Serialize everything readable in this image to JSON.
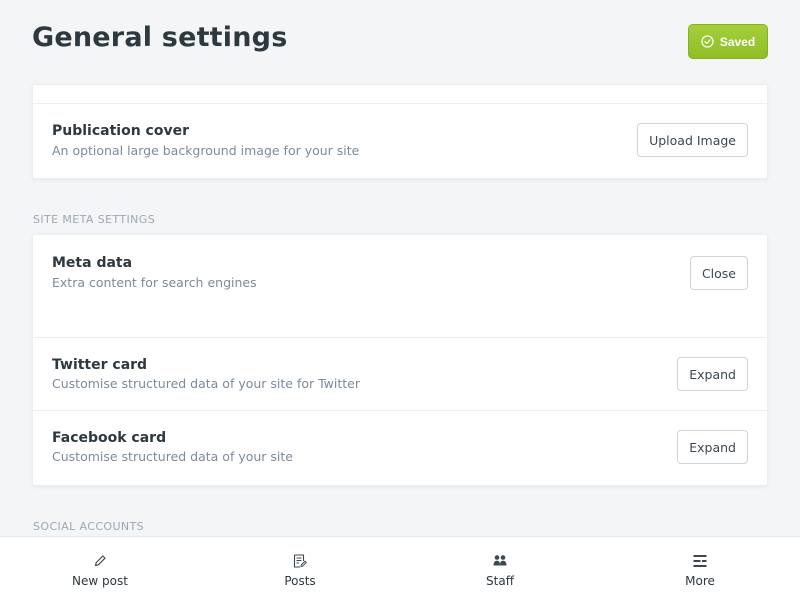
{
  "header": {
    "title": "General settings",
    "saved_label": "Saved",
    "saved_color": "#9ccb36"
  },
  "publication": {
    "cover_title": "Publication cover",
    "cover_desc": "An optional large background image for your site",
    "upload_label": "Upload Image"
  },
  "site_meta": {
    "section_label": "SITE META SETTINGS",
    "rows": [
      {
        "title": "Meta data",
        "desc": "Extra content for search engines",
        "button": "Close"
      },
      {
        "title": "Twitter card",
        "desc": "Customise structured data of your site for Twitter",
        "button": "Expand"
      },
      {
        "title": "Facebook card",
        "desc": "Customise structured data of your site",
        "button": "Expand"
      }
    ]
  },
  "social": {
    "section_label": "SOCIAL ACCOUNTS"
  },
  "bottom_nav": {
    "items": [
      {
        "label": "New post",
        "icon": "pencil-icon"
      },
      {
        "label": "Posts",
        "icon": "posts-icon"
      },
      {
        "label": "Staff",
        "icon": "staff-icon"
      },
      {
        "label": "More",
        "icon": "more-icon"
      }
    ]
  }
}
